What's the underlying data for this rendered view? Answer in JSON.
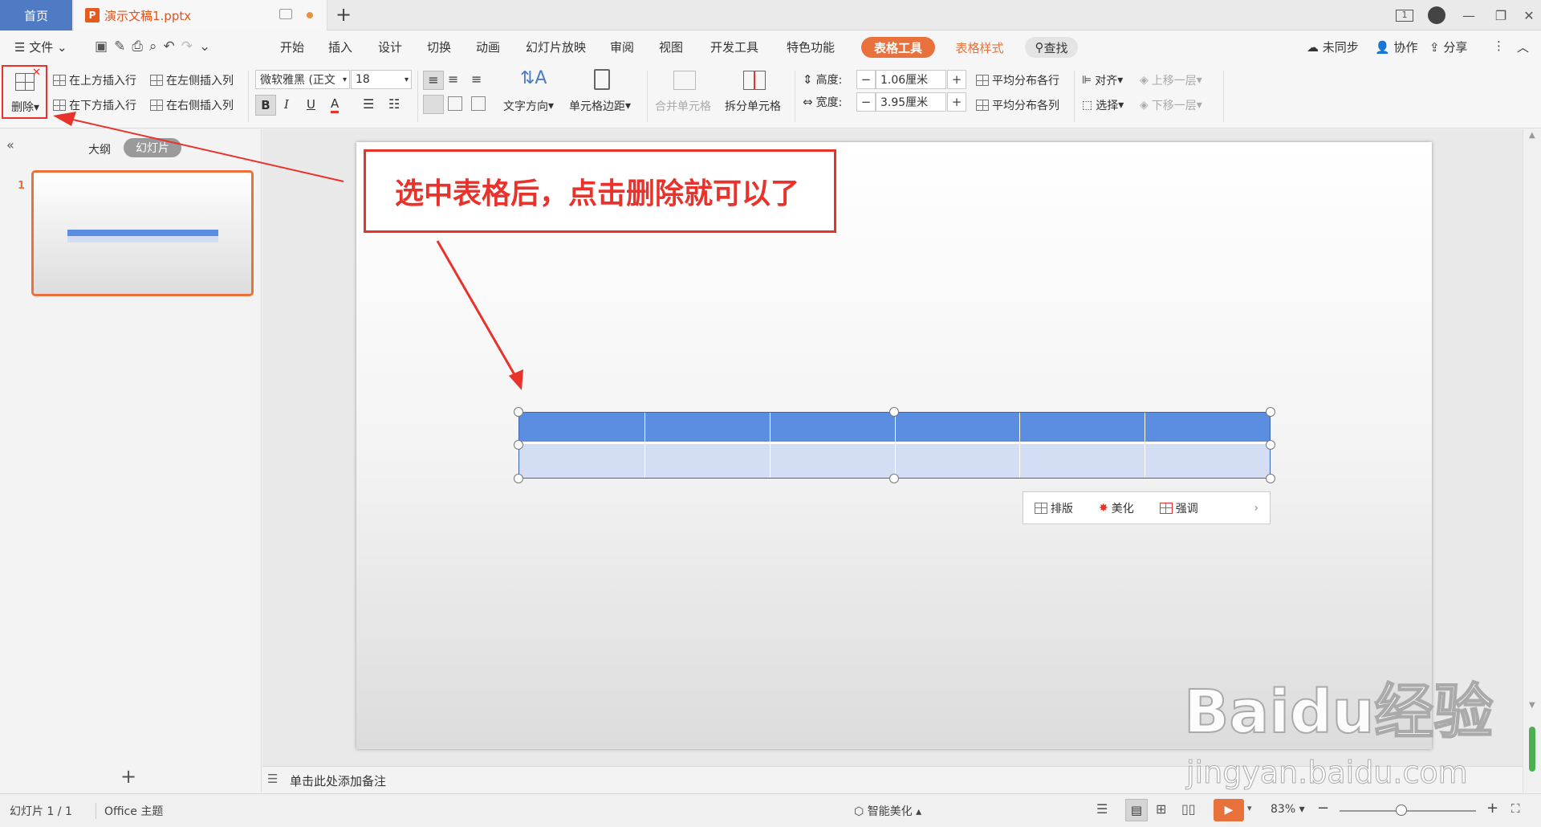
{
  "tabs": {
    "home": "首页",
    "doc": "演示文稿1.pptx",
    "doc_icon": "P",
    "new_tab": "+"
  },
  "menu": {
    "file": "文件",
    "items": [
      "开始",
      "插入",
      "设计",
      "切换",
      "动画",
      "幻灯片放映",
      "审阅",
      "视图",
      "开发工具",
      "特色功能"
    ],
    "table_tools": "表格工具",
    "table_style": "表格样式",
    "search": "查找",
    "right": [
      "未同步",
      "协作",
      "分享"
    ]
  },
  "ribbon": {
    "delete": "删除",
    "insert_above": "在上方插入行",
    "insert_below": "在下方插入行",
    "insert_left": "在左侧插入列",
    "insert_right": "在右侧插入列",
    "font_name": "微软雅黑 (正文",
    "font_size": "18",
    "text_direction": "文字方向",
    "cell_margin": "单元格边距",
    "merge_cells": "合并单元格",
    "split_cells": "拆分单元格",
    "height_label": "高度:",
    "height_value": "1.06厘米",
    "width_label": "宽度:",
    "width_value": "3.95厘米",
    "dist_rows": "平均分布各行",
    "dist_cols": "平均分布各列",
    "align": "对齐",
    "select": "选择",
    "bring_forward": "上移一层",
    "send_backward": "下移一层",
    "bold": "B",
    "italic": "I",
    "underline": "U",
    "font_color": "A"
  },
  "left_panel": {
    "outline": "大纲",
    "slides": "幻灯片",
    "slide_number": "1",
    "add": "+"
  },
  "annotation": {
    "text": "选中表格后，点击删除就可以了"
  },
  "float_toolbar": {
    "layout": "排版",
    "beautify": "美化",
    "emphasis": "强调"
  },
  "notes": {
    "placeholder": "单击此处添加备注"
  },
  "status": {
    "slide_info": "幻灯片 1 / 1",
    "theme": "Office 主题",
    "smart_beautify": "智能美化",
    "zoom": "83%",
    "zoom_level": 0.45
  },
  "watermark": {
    "brand": "Baidu经验",
    "url": "jingyan.baidu.com"
  },
  "colors": {
    "accent": "#4f7bc4",
    "orange": "#e8713c",
    "annotation_red": "#e8322b",
    "table_header": "#5b8ee0",
    "table_body": "#d3def5"
  },
  "table": {
    "columns": 6,
    "rows": 2
  }
}
